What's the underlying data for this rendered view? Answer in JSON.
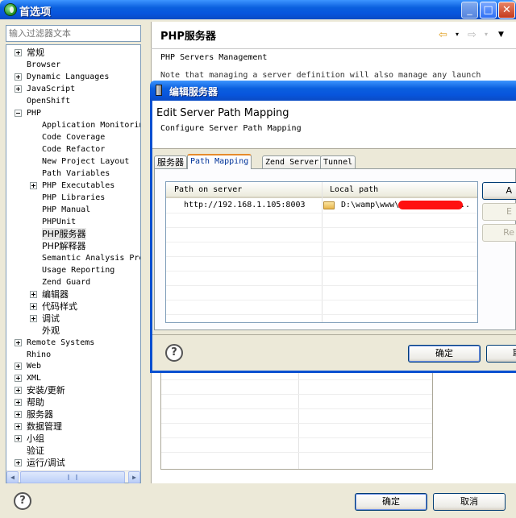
{
  "window": {
    "title": "首选项",
    "controls": {
      "minimize": "_",
      "maximize": "□",
      "close": "✕"
    }
  },
  "filter": {
    "placeholder": "输入过滤器文本"
  },
  "tree": [
    {
      "label": "常规",
      "indent": 0,
      "expander": "plus"
    },
    {
      "label": "Browser",
      "indent": 0,
      "expander": "none"
    },
    {
      "label": "Dynamic Languages",
      "indent": 0,
      "expander": "plus"
    },
    {
      "label": "JavaScript",
      "indent": 0,
      "expander": "plus"
    },
    {
      "label": "OpenShift",
      "indent": 0,
      "expander": "none"
    },
    {
      "label": "PHP",
      "indent": 0,
      "expander": "minus"
    },
    {
      "label": "Application Monitoring",
      "indent": 1,
      "expander": "none"
    },
    {
      "label": "Code Coverage",
      "indent": 1,
      "expander": "none"
    },
    {
      "label": "Code Refactor",
      "indent": 1,
      "expander": "none"
    },
    {
      "label": "New Project Layout",
      "indent": 1,
      "expander": "none"
    },
    {
      "label": "Path Variables",
      "indent": 1,
      "expander": "none"
    },
    {
      "label": "PHP Executables",
      "indent": 1,
      "expander": "plus"
    },
    {
      "label": "PHP Libraries",
      "indent": 1,
      "expander": "none"
    },
    {
      "label": "PHP Manual",
      "indent": 1,
      "expander": "none"
    },
    {
      "label": "PHPUnit",
      "indent": 1,
      "expander": "none"
    },
    {
      "label": "PHP服务器",
      "indent": 1,
      "expander": "none",
      "selected": true
    },
    {
      "label": "PHP解释器",
      "indent": 1,
      "expander": "none"
    },
    {
      "label": "Semantic Analysis Properties",
      "indent": 1,
      "expander": "none"
    },
    {
      "label": "Usage Reporting",
      "indent": 1,
      "expander": "none"
    },
    {
      "label": "Zend Guard",
      "indent": 1,
      "expander": "none"
    },
    {
      "label": "编辑器",
      "indent": 1,
      "expander": "plus"
    },
    {
      "label": "代码样式",
      "indent": 1,
      "expander": "plus"
    },
    {
      "label": "调试",
      "indent": 1,
      "expander": "plus"
    },
    {
      "label": "外观",
      "indent": 1,
      "expander": "none"
    },
    {
      "label": "Remote Systems",
      "indent": 0,
      "expander": "plus"
    },
    {
      "label": "Rhino",
      "indent": 0,
      "expander": "none"
    },
    {
      "label": "Web",
      "indent": 0,
      "expander": "plus"
    },
    {
      "label": "XML",
      "indent": 0,
      "expander": "plus"
    },
    {
      "label": "安装/更新",
      "indent": 0,
      "expander": "plus"
    },
    {
      "label": "帮助",
      "indent": 0,
      "expander": "plus"
    },
    {
      "label": "服务器",
      "indent": 0,
      "expander": "plus"
    },
    {
      "label": "数据管理",
      "indent": 0,
      "expander": "plus"
    },
    {
      "label": "小组",
      "indent": 0,
      "expander": "plus"
    },
    {
      "label": "验证",
      "indent": 0,
      "expander": "none"
    },
    {
      "label": "运行/调试",
      "indent": 0,
      "expander": "plus"
    }
  ],
  "right": {
    "title": "PHP服务器",
    "description": "PHP Servers Management",
    "note": "Note that managing a server definition will also manage any launch"
  },
  "dialog": {
    "title": "编辑服务器",
    "heading": "Edit Server Path Mapping",
    "subheading": "Configure Server Path Mapping",
    "tabs": [
      "服务器",
      "Path Mapping",
      "Zend Server",
      "Tunnel"
    ],
    "active_tab": 1,
    "columns": [
      "Path on server",
      "Local path"
    ],
    "rows": [
      {
        "server_path": "http://192.168.1.105:8003",
        "local_path": "D:\\wamp\\www\\",
        "local_path_suffix": ".."
      }
    ],
    "side_buttons": [
      "A",
      "E",
      "Re"
    ],
    "ok": "确定",
    "cancel": "取"
  },
  "bottom": {
    "ok": "确定",
    "cancel": "取消"
  },
  "colors": {
    "titlebar": "#0a5fde",
    "redaction": "#ff1010",
    "active_tab": "#e68b2c"
  }
}
